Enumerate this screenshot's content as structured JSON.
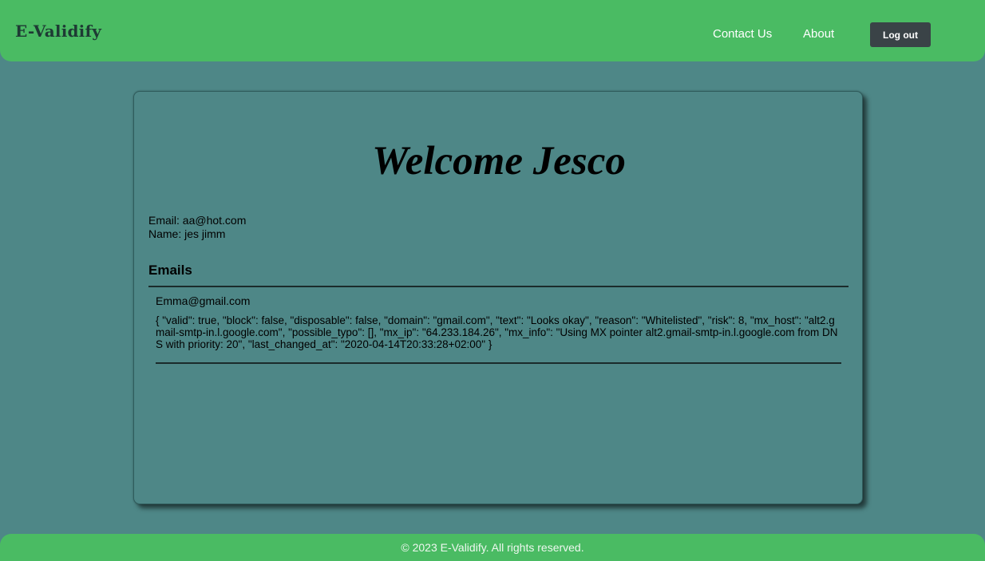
{
  "navbar": {
    "brand": "E-Validify",
    "links": [
      "Contact Us",
      "About"
    ],
    "logout_label": "Log out"
  },
  "profile": {
    "welcome": "Welcome Jesco",
    "email_line": "Email: aa@hot.com",
    "name_line": "Name: jes jimm"
  },
  "emails": {
    "heading": "Emails",
    "items": [
      {
        "address": "Emma@gmail.com",
        "result": "{ \"valid\": true, \"block\": false, \"disposable\": false, \"domain\": \"gmail.com\", \"text\": \"Looks okay\", \"reason\": \"Whitelisted\", \"risk\": 8, \"mx_host\": \"alt2.gmail-smtp-in.l.google.com\", \"possible_typo\": [], \"mx_ip\": \"64.233.184.26\", \"mx_info\": \"Using MX pointer alt2.gmail-smtp-in.l.google.com from DNS with priority: 20\", \"last_changed_at\": \"2020-04-14T20:33:28+02:00\" }"
      }
    ]
  },
  "footer": {
    "text": "© 2023 E-Validify. All rights reserved."
  },
  "colors": {
    "background": "#4e8787",
    "navbar": "#4abb63",
    "button": "#3a4347"
  }
}
